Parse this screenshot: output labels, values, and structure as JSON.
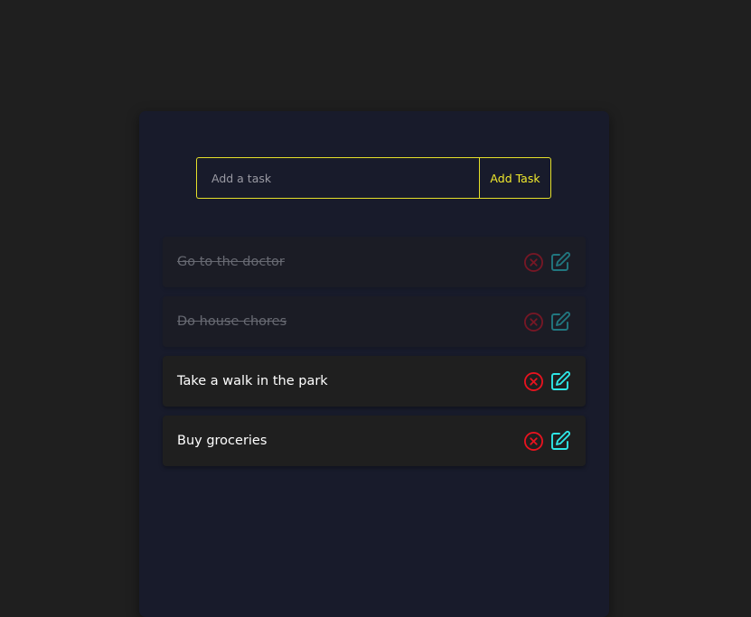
{
  "input": {
    "placeholder": "Add a task",
    "value": ""
  },
  "add_button_label": "Add Task",
  "colors": {
    "accent_yellow": "#e5e02a",
    "delete_red": "#e8131f",
    "edit_cyan": "#2ee6e6",
    "card_bg": "#181b2b",
    "task_bg": "#1f1f1f"
  },
  "tasks": [
    {
      "text": "Go to the doctor",
      "completed": true,
      "delete_icon": "close-circle-icon",
      "edit_icon": "edit-icon"
    },
    {
      "text": "Do house chores",
      "completed": true,
      "delete_icon": "close-circle-icon",
      "edit_icon": "edit-icon"
    },
    {
      "text": "Take a walk in the park",
      "completed": false,
      "delete_icon": "close-circle-icon",
      "edit_icon": "edit-icon"
    },
    {
      "text": "Buy groceries",
      "completed": false,
      "delete_icon": "close-circle-icon",
      "edit_icon": "edit-icon"
    }
  ]
}
